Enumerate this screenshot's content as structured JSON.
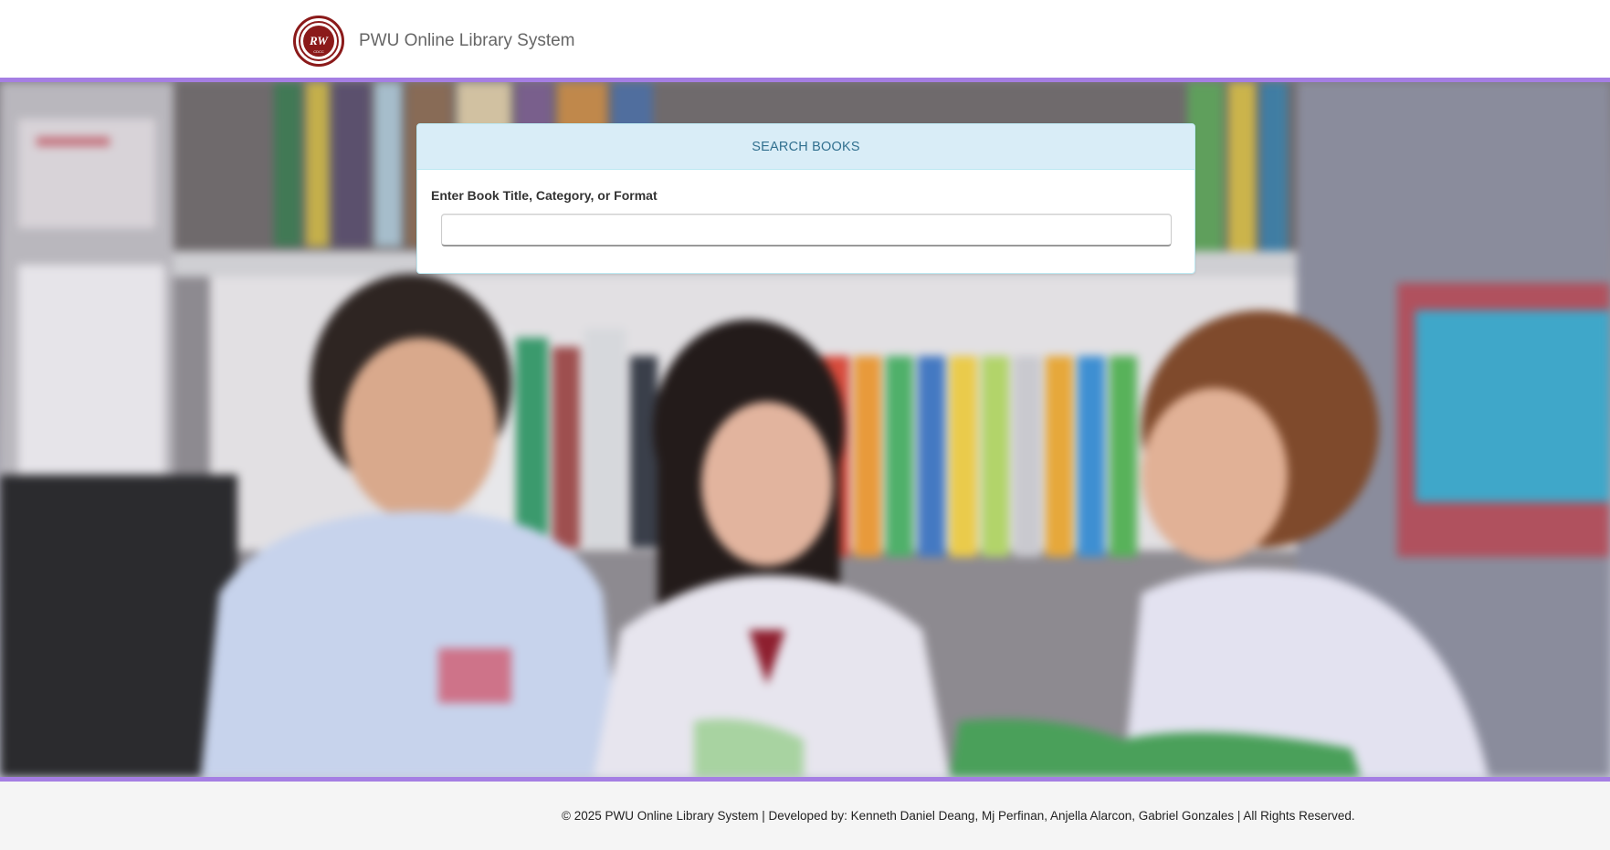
{
  "header": {
    "app_name": "PWU Online Library System",
    "logo_icon": "pwu-seal-logo",
    "logo_text": "PWU",
    "accent_color": "#a57ee3",
    "logo_color": "#8b1a1a"
  },
  "search_panel": {
    "title": "SEARCH BOOKS",
    "field_label": "Enter Book Title, Category, or Format",
    "input_value": "",
    "input_placeholder": ""
  },
  "hero": {
    "image": "library-students-photo"
  },
  "footer": {
    "text": "© 2025 PWU Online Library System | Developed by: Kenneth Daniel Deang, Mj Perfinan, Anjella Alarcon, Gabriel Gonzales | All Rights Reserved."
  }
}
